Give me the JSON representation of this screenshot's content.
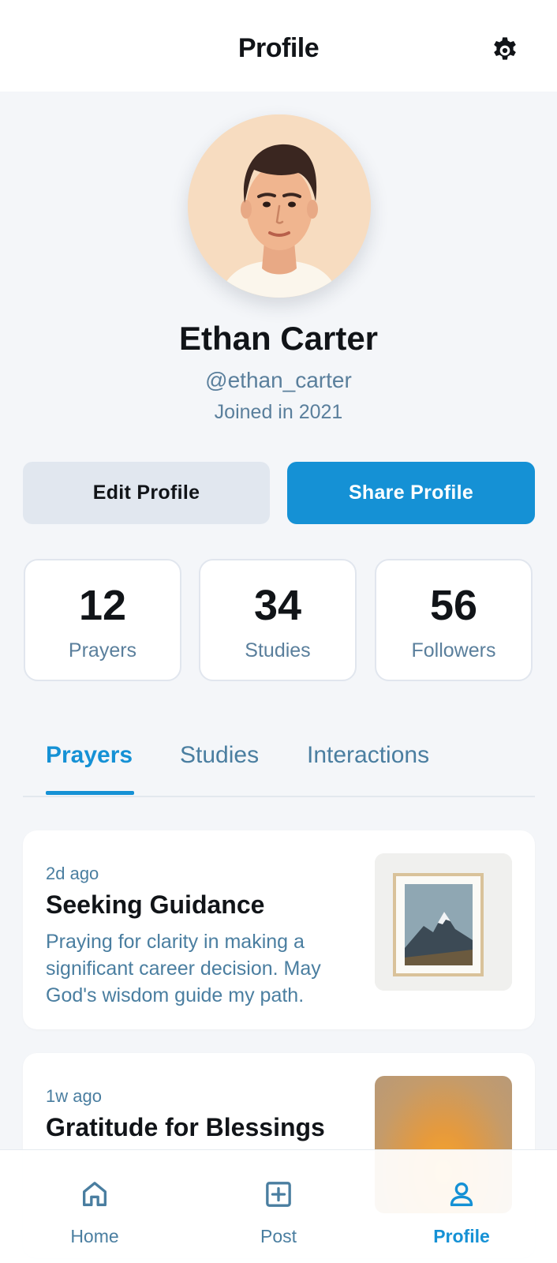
{
  "header": {
    "title": "Profile",
    "settings_icon": "gear-icon"
  },
  "profile": {
    "name": "Ethan Carter",
    "handle": "@ethan_carter",
    "joined": "Joined in 2021"
  },
  "actions": {
    "edit_label": "Edit Profile",
    "share_label": "Share Profile"
  },
  "stats": [
    {
      "value": "12",
      "label": "Prayers"
    },
    {
      "value": "34",
      "label": "Studies"
    },
    {
      "value": "56",
      "label": "Followers"
    }
  ],
  "tabs": [
    {
      "label": "Prayers",
      "active": true
    },
    {
      "label": "Studies",
      "active": false
    },
    {
      "label": "Interactions",
      "active": false
    }
  ],
  "posts": [
    {
      "time": "2d ago",
      "title": "Seeking Guidance",
      "body": "Praying for clarity in making a significant career decision. May God's wisdom guide my path.",
      "image": "framed-mountain-picture"
    },
    {
      "time": "1w ago",
      "title": "Gratitude for Blessings",
      "body": "",
      "image": "sunset-picture"
    }
  ],
  "nav": [
    {
      "label": "Home",
      "icon": "home-icon",
      "active": false
    },
    {
      "label": "Post",
      "icon": "plus-square-icon",
      "active": false
    },
    {
      "label": "Profile",
      "icon": "person-icon",
      "active": true
    }
  ],
  "colors": {
    "accent": "#1591d5",
    "muted_text": "#4a7ea0",
    "background": "#f4f6f9",
    "edit_button": "#e1e7ef"
  }
}
